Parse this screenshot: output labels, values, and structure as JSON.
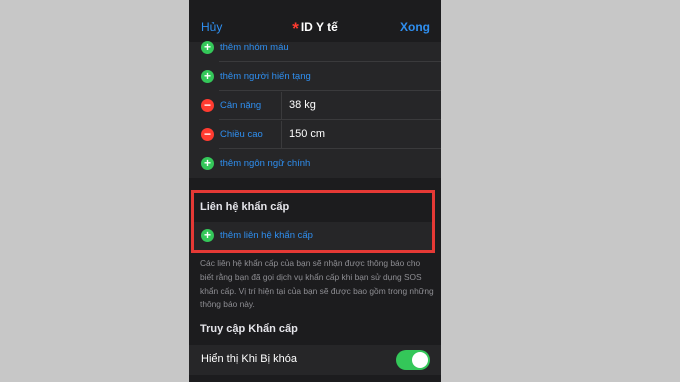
{
  "nav": {
    "cancel": "Hủy",
    "title": "ID Y tế",
    "done": "Xong"
  },
  "medical_info": {
    "rows": [
      {
        "type": "add",
        "label": "thêm nhóm máu"
      },
      {
        "type": "add",
        "label": "thêm người hiến tạng"
      },
      {
        "type": "remove",
        "label": "Cân nặng",
        "value": "38 kg"
      },
      {
        "type": "remove",
        "label": "Chiều cao",
        "value": "150 cm"
      },
      {
        "type": "add",
        "label": "thêm ngôn ngữ chính"
      }
    ]
  },
  "emergency_contacts": {
    "header": "Liên hệ khẩn cấp",
    "add_label": "thêm liên hệ khẩn cấp",
    "footnote": "Các liên hệ khẩn cấp của bạn sẽ nhận được thông báo cho biết rằng bạn đã gọi dịch vụ khẩn cấp khi bạn sử dụng SOS khẩn cấp. Vị trí hiện tại của bạn sẽ được bao gồm trong những thông báo này."
  },
  "emergency_access": {
    "header": "Truy cập Khẩn cấp",
    "show_when_locked_label": "Hiển thị Khi Bị khóa",
    "show_when_locked_on": true
  },
  "colors": {
    "accent": "#2f8ff0",
    "highlight": "#e53935",
    "toggle_on": "#34c759"
  }
}
